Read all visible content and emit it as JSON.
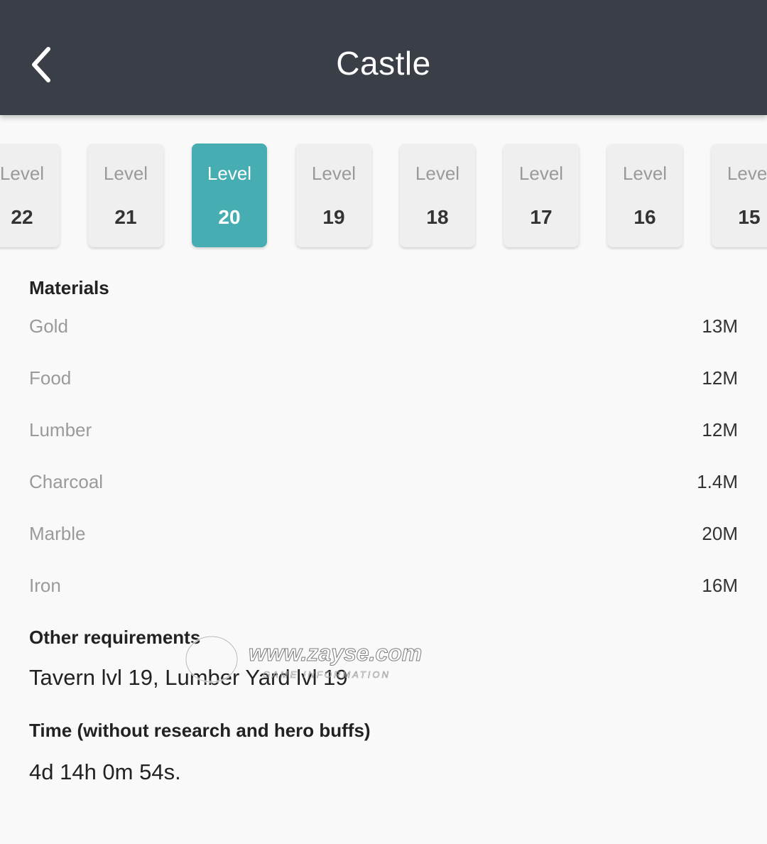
{
  "header": {
    "title": "Castle"
  },
  "levels": [
    {
      "label": "Level",
      "number": "22"
    },
    {
      "label": "Level",
      "number": "21"
    },
    {
      "label": "Level",
      "number": "20"
    },
    {
      "label": "Level",
      "number": "19"
    },
    {
      "label": "Level",
      "number": "18"
    },
    {
      "label": "Level",
      "number": "17"
    },
    {
      "label": "Level",
      "number": "16"
    },
    {
      "label": "Level",
      "number": "15"
    }
  ],
  "selected_level": "20",
  "materials": {
    "title": "Materials",
    "items": [
      {
        "name": "Gold",
        "value": "13M"
      },
      {
        "name": "Food",
        "value": "12M"
      },
      {
        "name": "Lumber",
        "value": "12M"
      },
      {
        "name": "Charcoal",
        "value": "1.4M"
      },
      {
        "name": "Marble",
        "value": "20M"
      },
      {
        "name": "Iron",
        "value": "16M"
      }
    ]
  },
  "requirements": {
    "title": "Other requirements",
    "text": "Tavern lvl 19, Lumber Yard lvl 19"
  },
  "time": {
    "title": "Time (without research and hero buffs)",
    "text": "4d 14h 0m 54s."
  },
  "watermark": {
    "site": "www.zayse.com",
    "tagline": "GAME INFORMATION"
  },
  "colors": {
    "header_bg": "#3a3f47",
    "accent": "#46aeb2",
    "page_bg": "#f9f9f9"
  }
}
